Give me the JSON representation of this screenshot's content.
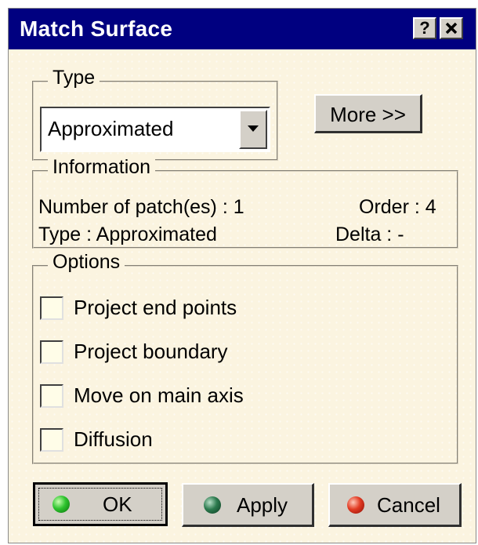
{
  "window": {
    "title": "Match Surface",
    "help_label": "?",
    "close_label": "✕"
  },
  "type_group": {
    "legend": "Type",
    "selected": "Approximated"
  },
  "more_button": "More >>",
  "information": {
    "legend": "Information",
    "patches": "Number of patch(es) : 1",
    "order": "Order : 4",
    "type": "Type : Approximated",
    "delta": "Delta : -"
  },
  "options": {
    "legend": "Options",
    "items": [
      {
        "label": "Project end points",
        "checked": false
      },
      {
        "label": "Project boundary",
        "checked": false
      },
      {
        "label": "Move on main axis",
        "checked": false
      },
      {
        "label": "Diffusion",
        "checked": false
      }
    ]
  },
  "buttons": {
    "ok": {
      "label": "OK",
      "icon": "green-ball-icon",
      "color": "#1fb31f"
    },
    "apply": {
      "label": "Apply",
      "icon": "dark-green-ball-icon",
      "color": "#1e5e3a"
    },
    "cancel": {
      "label": "Cancel",
      "icon": "red-ball-icon",
      "color": "#d42a1f"
    }
  }
}
